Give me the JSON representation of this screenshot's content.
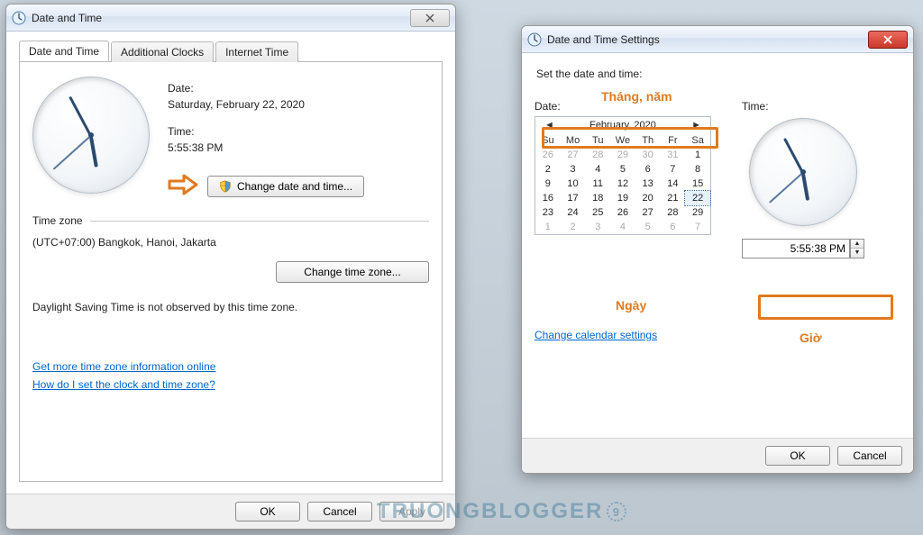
{
  "win1": {
    "title": "Date and Time",
    "tabs": [
      "Date and Time",
      "Additional Clocks",
      "Internet Time"
    ],
    "date_label": "Date:",
    "date_value": "Saturday, February 22, 2020",
    "time_label": "Time:",
    "time_value": "5:55:38 PM",
    "change_dt_btn": "Change date and time...",
    "tz_section": "Time zone",
    "tz_value": "(UTC+07:00) Bangkok, Hanoi, Jakarta",
    "change_tz_btn": "Change time zone...",
    "dst_note": "Daylight Saving Time is not observed by this time zone.",
    "link1": "Get more time zone information online",
    "link2": "How do I set the clock and time zone?",
    "ok": "OK",
    "cancel": "Cancel",
    "apply": "Apply"
  },
  "win2": {
    "title": "Date and Time Settings",
    "heading": "Set the date and time:",
    "date_label": "Date:",
    "time_label": "Time:",
    "month_year": "February, 2020",
    "dow": [
      "Su",
      "Mo",
      "Tu",
      "We",
      "Th",
      "Fr",
      "Sa"
    ],
    "weeks": [
      [
        {
          "d": 26,
          "o": 1
        },
        {
          "d": 27,
          "o": 1
        },
        {
          "d": 28,
          "o": 1
        },
        {
          "d": 29,
          "o": 1
        },
        {
          "d": 30,
          "o": 1
        },
        {
          "d": 31,
          "o": 1
        },
        {
          "d": 1
        }
      ],
      [
        {
          "d": 2
        },
        {
          "d": 3
        },
        {
          "d": 4
        },
        {
          "d": 5
        },
        {
          "d": 6
        },
        {
          "d": 7
        },
        {
          "d": 8
        }
      ],
      [
        {
          "d": 9
        },
        {
          "d": 10
        },
        {
          "d": 11
        },
        {
          "d": 12
        },
        {
          "d": 13
        },
        {
          "d": 14
        },
        {
          "d": 15
        }
      ],
      [
        {
          "d": 16
        },
        {
          "d": 17
        },
        {
          "d": 18
        },
        {
          "d": 19
        },
        {
          "d": 20
        },
        {
          "d": 21
        },
        {
          "d": 22,
          "sel": 1
        }
      ],
      [
        {
          "d": 23
        },
        {
          "d": 24
        },
        {
          "d": 25
        },
        {
          "d": 26
        },
        {
          "d": 27
        },
        {
          "d": 28
        },
        {
          "d": 29
        }
      ],
      [
        {
          "d": 1,
          "o": 1
        },
        {
          "d": 2,
          "o": 1
        },
        {
          "d": 3,
          "o": 1
        },
        {
          "d": 4,
          "o": 1
        },
        {
          "d": 5,
          "o": 1
        },
        {
          "d": 6,
          "o": 1
        },
        {
          "d": 7,
          "o": 1
        }
      ]
    ],
    "time_value": "5:55:38 PM",
    "link": "Change calendar settings",
    "ok": "OK",
    "cancel": "Cancel"
  },
  "annotations": {
    "thang_nam": "Tháng, năm",
    "ngay": "Ngày",
    "gio": "Giờ"
  },
  "watermark": "TRUONGBLOGGER"
}
